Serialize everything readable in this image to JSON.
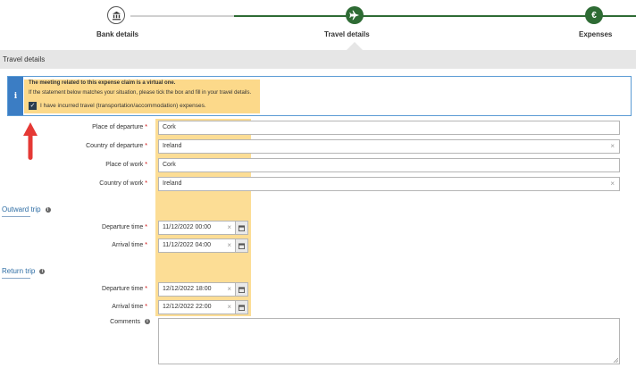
{
  "stepper": {
    "steps": [
      {
        "label": "Bank details",
        "icon": "bank-icon",
        "state": "done"
      },
      {
        "label": "Travel details",
        "icon": "plane-icon",
        "state": "current"
      },
      {
        "label": "Expenses",
        "icon": "euro-icon",
        "state": "upcoming"
      }
    ],
    "euro_glyph": "€"
  },
  "section": {
    "title": "Travel details"
  },
  "info": {
    "title": "The meeting related to this expense claim is a virtual one.",
    "text": "If the statement below matches your situation, please tick the box and fill in your travel details.",
    "checkbox_label": "I have incurred travel (transportation/accommodation) expenses.",
    "checkbox_checked": true
  },
  "form": {
    "place_of_departure": {
      "label": "Place of departure",
      "value": "Cork"
    },
    "country_of_departure": {
      "label": "Country of departure",
      "value": "Ireland"
    },
    "place_of_work": {
      "label": "Place of work",
      "value": "Cork"
    },
    "country_of_work": {
      "label": "Country of work",
      "value": "Ireland"
    },
    "outward_trip": {
      "heading": "Outward trip",
      "departure": {
        "label": "Departure time",
        "value": "11/12/2022 00:00"
      },
      "arrival": {
        "label": "Arrival time",
        "value": "11/12/2022 04:00"
      }
    },
    "return_trip": {
      "heading": "Return trip",
      "departure": {
        "label": "Departure time",
        "value": "12/12/2022 18:00"
      },
      "arrival": {
        "label": "Arrival time",
        "value": "12/12/2022 22:00"
      }
    },
    "comments": {
      "label": "Comments",
      "value": ""
    }
  },
  "colors": {
    "accent_green": "#2e6b34",
    "highlight": "#fcd98a",
    "info_blue": "#3b7dc4",
    "arrow_red": "#e53935"
  }
}
